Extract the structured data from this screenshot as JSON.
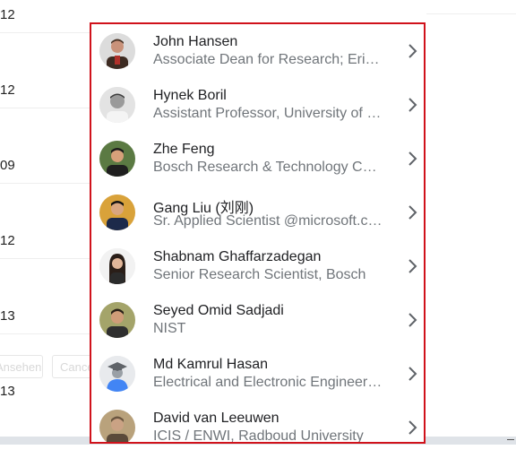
{
  "background": {
    "years": [
      "12",
      "12",
      "09",
      "12",
      "13",
      "13"
    ],
    "buttons": [
      "Ansehen",
      "Cancel"
    ]
  },
  "people": [
    {
      "name": "John Hansen",
      "affiliation": "Associate Dean for Research; Erik Jonsson School of Engineering",
      "avatar": "photo-john-hansen"
    },
    {
      "name": "Hynek Boril",
      "affiliation": "Assistant Professor, University of Wisconsin",
      "avatar": "photo-hynek-boril"
    },
    {
      "name": "Zhe Feng",
      "affiliation": "Bosch Research & Technology Center",
      "avatar": "photo-zhe-feng"
    },
    {
      "name": "Gang Liu (刘刚)",
      "affiliation": "Sr. Applied Scientist @microsoft.com",
      "avatar": "photo-gang-liu"
    },
    {
      "name": "Shabnam Ghaffarzadegan",
      "affiliation": "Senior Research Scientist, Bosch",
      "avatar": "photo-shabnam-ghaffarzadegan"
    },
    {
      "name": "Seyed Omid Sadjadi",
      "affiliation": "NIST",
      "avatar": "photo-seyed-omid-sadjadi"
    },
    {
      "name": "Md Kamrul Hasan",
      "affiliation": "Electrical and Electronic Engineering",
      "avatar": "default-graduate-avatar"
    },
    {
      "name": "David van Leeuwen",
      "affiliation": "ICIS / ENWI, Radboud University",
      "avatar": "photo-david-van-leeuwen"
    }
  ],
  "colors": {
    "highlight_border": "#d0121b",
    "name_text": "#202124",
    "affiliation_text": "#70757a"
  }
}
